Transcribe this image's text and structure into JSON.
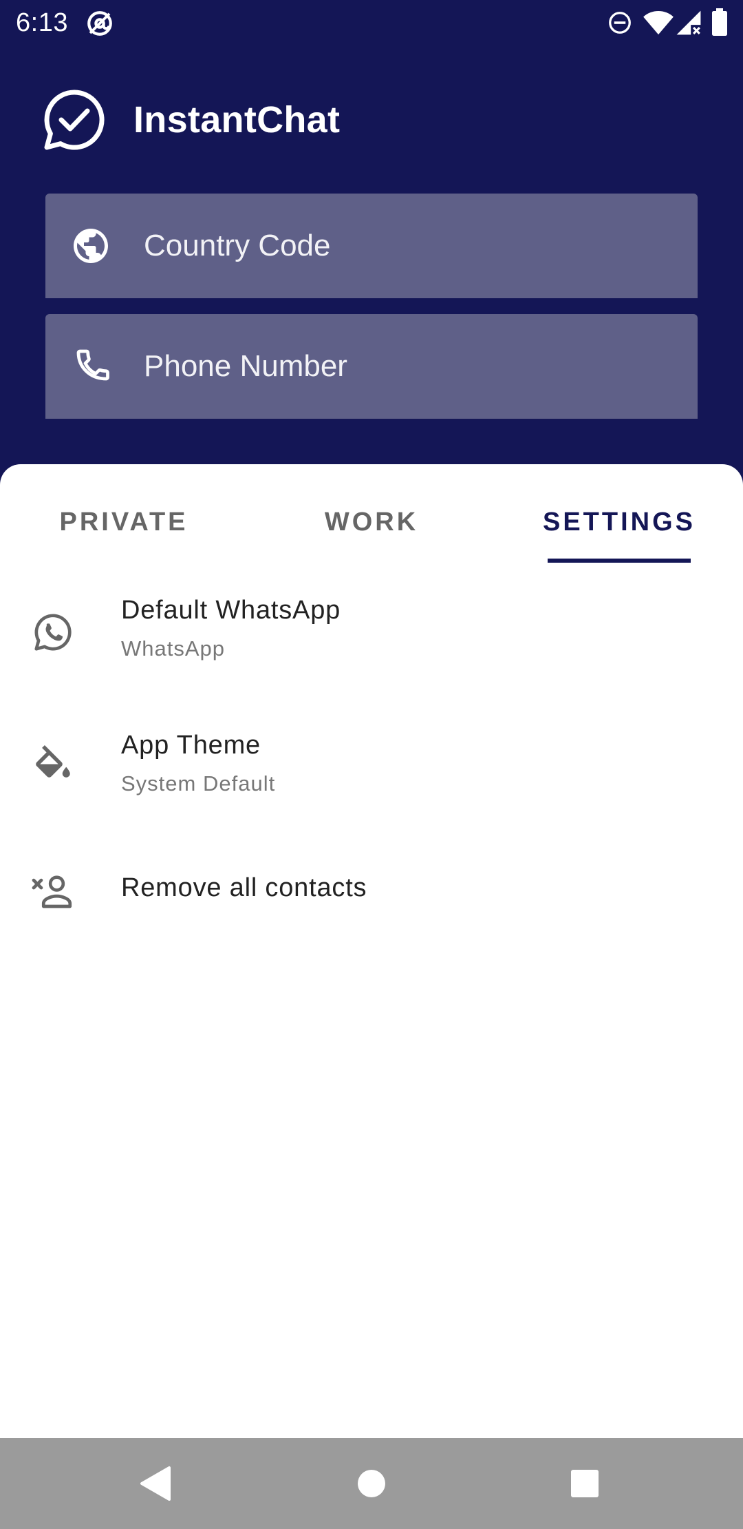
{
  "status_bar": {
    "time": "6:13",
    "icons": [
      "at-sign-icon",
      "do-not-disturb-icon",
      "wifi-icon",
      "signal-no-data-icon",
      "battery-icon"
    ]
  },
  "app": {
    "title": "InstantChat",
    "logo_icon": "chat-check-icon"
  },
  "inputs": {
    "country_code": {
      "placeholder": "Country Code",
      "value": "",
      "icon": "globe-icon"
    },
    "phone_number": {
      "placeholder": "Phone Number",
      "value": "",
      "icon": "phone-icon"
    }
  },
  "tabs": [
    {
      "label": "PRIVATE",
      "selected": false
    },
    {
      "label": "WORK",
      "selected": false
    },
    {
      "label": "SETTINGS",
      "selected": true
    }
  ],
  "settings": [
    {
      "title": "Default WhatsApp",
      "subtitle": "WhatsApp",
      "icon": "whatsapp-icon"
    },
    {
      "title": "App Theme",
      "subtitle": "System Default",
      "icon": "paint-bucket-icon"
    },
    {
      "title": "Remove all contacts",
      "icon": "remove-person-icon"
    }
  ],
  "nav_bar": {
    "buttons": [
      "back-icon",
      "home-icon",
      "recents-icon"
    ]
  },
  "colors": {
    "primary": "#141656",
    "input_background": "#5f6088",
    "tab_inactive": "#666666",
    "nav_bar": "#9b9b9b",
    "sheet": "#ffffff"
  }
}
